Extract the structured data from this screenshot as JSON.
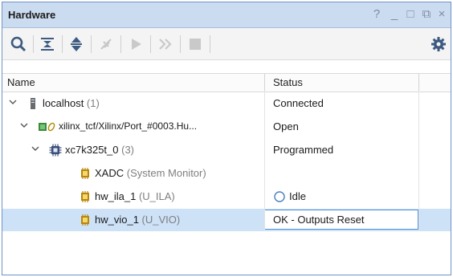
{
  "window": {
    "title": "Hardware",
    "controls": [
      "?",
      "_",
      "□",
      "⧉",
      "×"
    ]
  },
  "toolbar": {
    "icons": [
      "search-icon",
      "collapse-all-icon",
      "expand-all-icon",
      "auto-connect-icon",
      "run-icon",
      "run-all-icon",
      "stop-icon",
      "settings-icon"
    ]
  },
  "table": {
    "headers": {
      "name": "Name",
      "status": "Status"
    },
    "rows": [
      {
        "label": "localhost",
        "suffix": " (1)",
        "status": "Connected"
      },
      {
        "label": "xilinx_tcf/Xilinx/Port_#0003.Hu...",
        "suffix": "",
        "status": "Open"
      },
      {
        "label": "xc7k325t_0",
        "suffix": " (3)",
        "status": "Programmed"
      },
      {
        "label": "XADC",
        "suffix": " (System Monitor)",
        "status": ""
      },
      {
        "label": "hw_ila_1",
        "suffix": " (U_ILA)",
        "status": "Idle"
      },
      {
        "label": "hw_vio_1",
        "suffix": " (U_VIO)",
        "status": "OK - Outputs Reset"
      }
    ]
  }
}
